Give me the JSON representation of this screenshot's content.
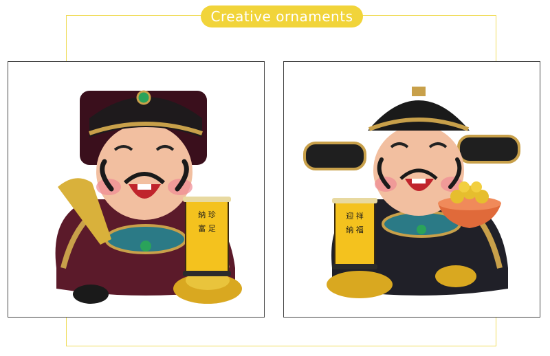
{
  "header": {
    "title": "Creative ornaments"
  },
  "products": [
    {
      "scroll_text": "納珍富足"
    },
    {
      "scroll_text": "迎祥納福"
    }
  ]
}
